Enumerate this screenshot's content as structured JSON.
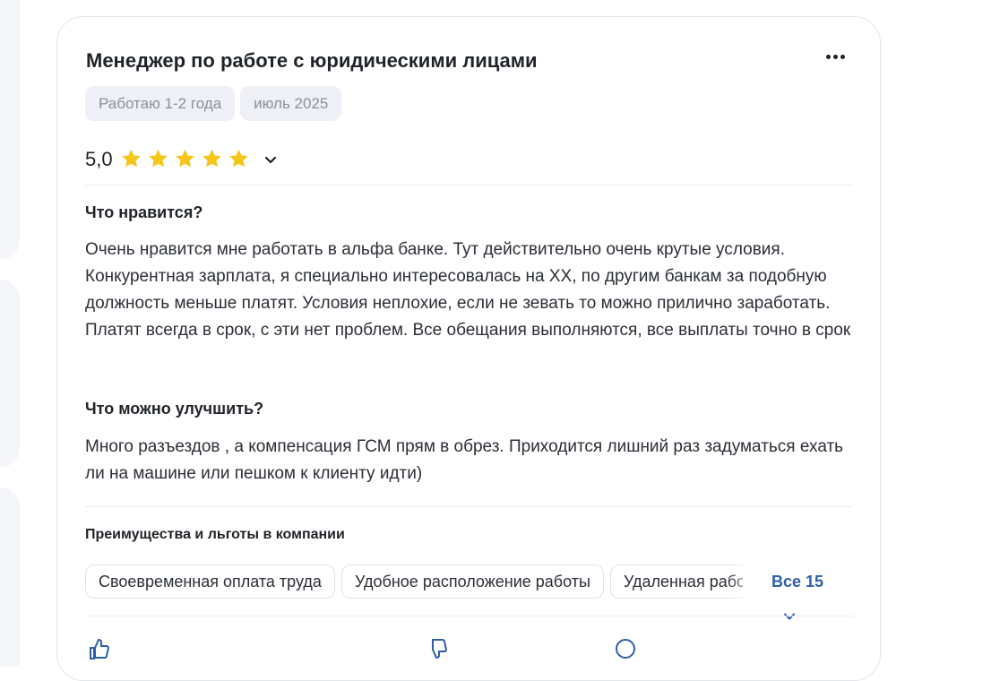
{
  "review": {
    "title": "Менеджер по работе с юридическими лицами",
    "tags": [
      "Работаю 1-2 года",
      "июль 2025"
    ],
    "rating": "5,0",
    "rating_stars": 5,
    "pros": {
      "heading": "Что нравится?",
      "text": "Очень нравится мне работать в альфа банке. Тут действительно очень крутые условия. Конкурентная зарплата, я специально интересовалась на ХХ, по другим банкам за подобную должность меньше платят. Условия неплохие, если не зевать то можно прилично заработать. Платят всегда в срок, с эти нет проблем. Все обещания выполняются, все выплаты точно в срок"
    },
    "cons": {
      "heading": "Что можно улучшить?",
      "text": "Много разъездов , а компенсация ГСМ прям в обрез. Приходится лишний раз задуматься ехать ли на машине или пешком к клиенту идти)"
    },
    "benefits": {
      "heading": "Преимущества и льготы в компании",
      "items": [
        "Своевременная оплата труда",
        "Удобное расположение работы",
        "Удаленная работа"
      ],
      "all_label": "Все 15"
    }
  },
  "colors": {
    "star": "#f5c518",
    "link": "#2f5ea8",
    "chip_bg": "#eef0f5"
  },
  "icons": [
    "more-icon",
    "star-icon",
    "chevron-down-icon",
    "like-icon",
    "dislike-icon",
    "comment-icon"
  ]
}
